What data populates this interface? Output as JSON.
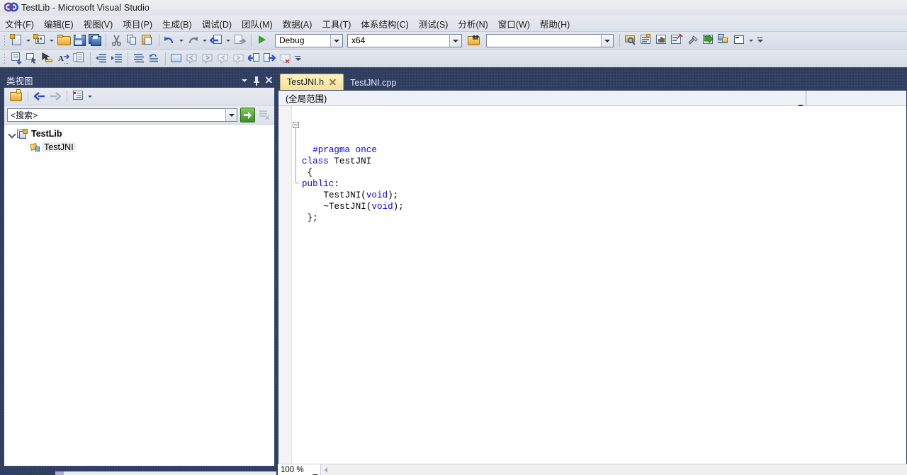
{
  "window": {
    "title": "TestLib - Microsoft Visual Studio",
    "logo_icon": "visual-studio-infinity-icon"
  },
  "menubar": {
    "items": [
      {
        "label": "文件(F)"
      },
      {
        "label": "编辑(E)"
      },
      {
        "label": "视图(V)"
      },
      {
        "label": "项目(P)"
      },
      {
        "label": "生成(B)"
      },
      {
        "label": "调试(D)"
      },
      {
        "label": "团队(M)"
      },
      {
        "label": "数据(A)"
      },
      {
        "label": "工具(T)"
      },
      {
        "label": "体系结构(C)"
      },
      {
        "label": "测试(S)"
      },
      {
        "label": "分析(N)"
      },
      {
        "label": "窗口(W)"
      },
      {
        "label": "帮助(H)"
      }
    ]
  },
  "toolbar": {
    "config_value": "Debug",
    "platform_value": "x64",
    "find_value": "",
    "icons": [
      "new-project-icon",
      "new-item-icon",
      "open-file-icon",
      "save-icon",
      "save-all-icon",
      "cut-icon",
      "copy-icon",
      "paste-icon",
      "undo-icon",
      "redo-icon",
      "navigate-backward-icon",
      "navigate-forward-icon",
      "start-debug-icon"
    ],
    "right_icons": [
      "find-in-files-icon",
      "properties-window-icon",
      "object-browser-icon",
      "toolbox-icon",
      "tools-options-icon",
      "start-without-debug-icon",
      "solution-explorer-icon",
      "command-window-icon"
    ],
    "row2_icons": [
      "comment-block-icon",
      "uncomment-block-icon",
      "toggle-bookmark-icon",
      "font-size-icon",
      "clipboard-ring-icon",
      "decrease-indent-icon",
      "increase-indent-icon",
      "format-document-icon",
      "undo-format-icon",
      "toggle-all-outlining-icon",
      "previous-bookmark-icon",
      "next-bookmark-icon",
      "clear-bookmarks-icon",
      "toggle-bookmark-folder-icon",
      "step-into-icon",
      "step-over-icon",
      "stop-icon"
    ]
  },
  "class_view": {
    "title": "类视图",
    "titlebar_icons": [
      "window-dropdown-icon",
      "auto-hide-pin-icon",
      "close-icon"
    ],
    "toolbar_icons": [
      "new-folder-icon",
      "back-icon",
      "forward-icon",
      "class-view-settings-icon",
      "settings-dropdown-icon"
    ],
    "search": {
      "value": "<搜索>",
      "go_label": "go-icon",
      "clear_label": "clear-search-icon"
    },
    "tree": [
      {
        "label": "TestLib",
        "icon": "project-icon",
        "level": 0,
        "expanded": true,
        "bold": true,
        "selected": false
      },
      {
        "label": "TestJNI",
        "icon": "class-icon",
        "level": 1,
        "expanded": false,
        "bold": false,
        "selected": true
      }
    ]
  },
  "editor": {
    "tabs": [
      {
        "label": "TestJNI.h",
        "active": true,
        "closable": true
      },
      {
        "label": "TestJNI.cpp",
        "active": false,
        "closable": false
      }
    ],
    "navigation_bar": {
      "scope_value": "(全局范围)",
      "member_value": ""
    },
    "code": [
      {
        "indent": 2,
        "tokens": [
          {
            "t": "#pragma once",
            "c": "pp"
          }
        ]
      },
      {
        "indent": 0,
        "fold": true,
        "tokens": [
          {
            "t": "class",
            "c": "kw"
          },
          {
            "t": " TestJNI",
            "c": "tok"
          }
        ]
      },
      {
        "indent": 1,
        "tokens": [
          {
            "t": "{",
            "c": "tok"
          }
        ]
      },
      {
        "indent": 0,
        "tokens": [
          {
            "t": "public",
            "c": "kw"
          },
          {
            "t": ":",
            "c": "tok"
          }
        ]
      },
      {
        "indent": 4,
        "tokens": [
          {
            "t": "TestJNI(",
            "c": "tok"
          },
          {
            "t": "void",
            "c": "kw"
          },
          {
            "t": ");",
            "c": "tok"
          }
        ]
      },
      {
        "indent": 4,
        "tokens": [
          {
            "t": "~TestJNI(",
            "c": "tok"
          },
          {
            "t": "void",
            "c": "kw"
          },
          {
            "t": ");",
            "c": "tok"
          }
        ]
      },
      {
        "indent": 1,
        "tokens": [
          {
            "t": "};",
            "c": "tok"
          }
        ]
      }
    ]
  },
  "statusbar": {
    "zoom_value": "100 %",
    "scroll_left_icon": "scroll-left-icon"
  },
  "colors": {
    "frame": "#2e3c60",
    "active_tab": "#f6e099",
    "keyword": "#0000ff",
    "accent_green": "#3c9021"
  }
}
